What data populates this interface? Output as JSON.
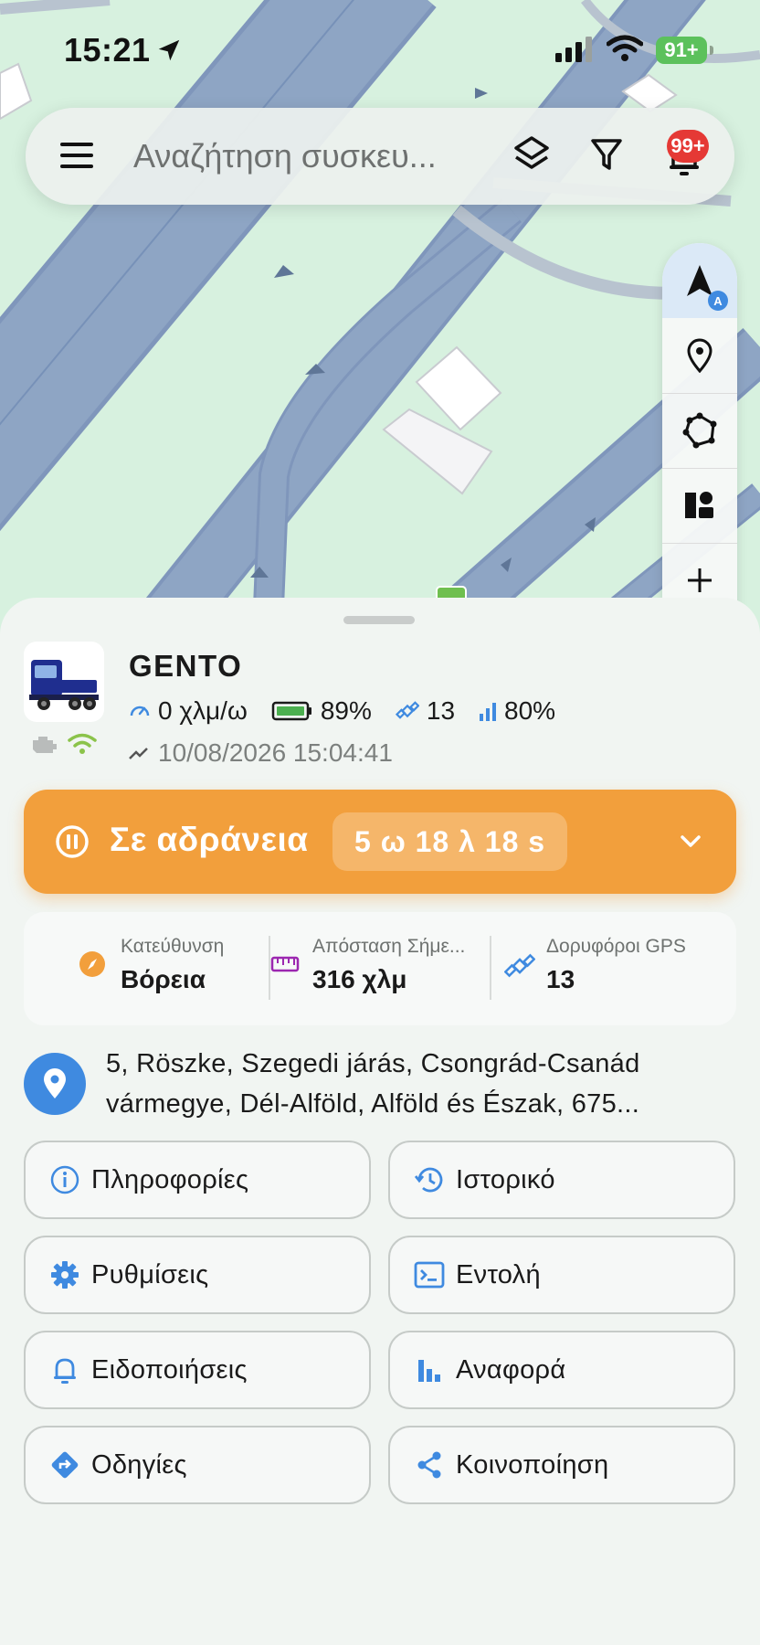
{
  "status_bar": {
    "time": "15:21",
    "battery": "91+"
  },
  "search": {
    "placeholder": "Αναζήτηση συσκευ...",
    "notification_badge": "99+"
  },
  "map_controls": [
    "navigate-icon",
    "pin-icon",
    "polygon-icon",
    "geofence-shapes-icon",
    "zoom-in-icon",
    "zoom-out-icon"
  ],
  "device": {
    "name": "GENTO",
    "speed": "0 χλμ/ω",
    "battery": "89%",
    "satellites": "13",
    "signal": "80%",
    "timestamp": "10/08/2026 15:04:41"
  },
  "status": {
    "label": "Σε αδράνεια",
    "duration": "5 ω 18 λ 18 s",
    "color": "#f29f3c"
  },
  "info": [
    {
      "label": "Κατεύθυνση",
      "value": "Βόρεια",
      "icon": "compass-icon"
    },
    {
      "label": "Απόσταση Σήμε...",
      "value": "316 χλμ",
      "icon": "ruler-icon"
    },
    {
      "label": "Δορυφόροι GPS",
      "value": "13",
      "icon": "satellite-icon"
    }
  ],
  "address": "5, Röszke, Szegedi járás, Csongrád-Csanád vármegye, Dél-Alföld, Alföld és Észak, 675...",
  "actions": {
    "info": "Πληροφορίες",
    "history": "Ιστορικό",
    "settings": "Ρυθμίσεις",
    "command": "Εντολή",
    "notifications": "Ειδοποιήσεις",
    "report": "Αναφορά",
    "directions": "Οδηγίες",
    "share": "Κοινοποίηση"
  },
  "colors": {
    "accent": "#3f8ae0",
    "idle": "#f29f3c",
    "map_bg": "#d7f1df",
    "road": "#8ea5c4"
  }
}
